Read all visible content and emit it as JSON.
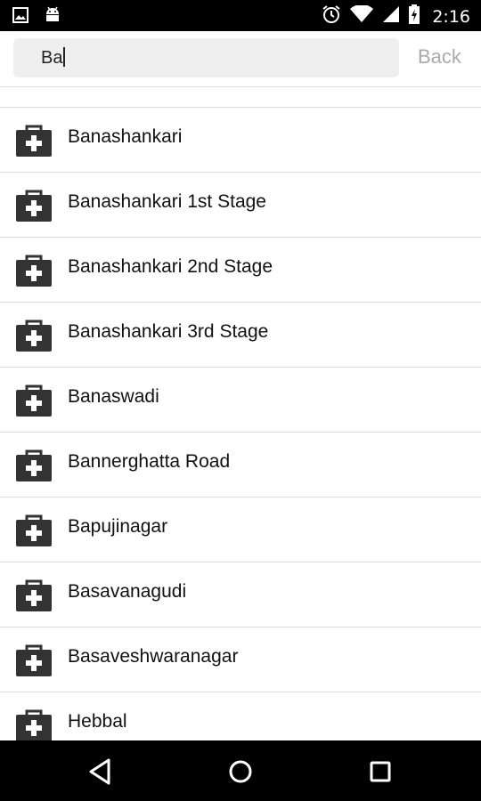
{
  "status_bar": {
    "time": "2:16",
    "left_icons": [
      "image-icon",
      "android-icon"
    ],
    "right_icons": [
      "alarm-icon",
      "wifi-icon",
      "signal-icon",
      "battery-icon"
    ]
  },
  "search": {
    "value": "Ba",
    "back_label": "Back"
  },
  "list": {
    "items": [
      {
        "label": "Banashankari"
      },
      {
        "label": "Banashankari 1st Stage"
      },
      {
        "label": "Banashankari 2nd Stage"
      },
      {
        "label": "Banashankari 3rd Stage"
      },
      {
        "label": "Banaswadi"
      },
      {
        "label": "Bannerghatta Road"
      },
      {
        "label": "Bapujinagar"
      },
      {
        "label": "Basavanagudi"
      },
      {
        "label": "Basaveshwaranagar"
      },
      {
        "label": "Hebbal"
      }
    ]
  },
  "nav": {
    "buttons": [
      "back-nav-icon",
      "home-nav-icon",
      "recents-nav-icon"
    ]
  },
  "colors": {
    "status_bar": "#000000",
    "search_bg": "#eeeeee",
    "back_text": "#aaaaaa",
    "icon": "#333333"
  }
}
